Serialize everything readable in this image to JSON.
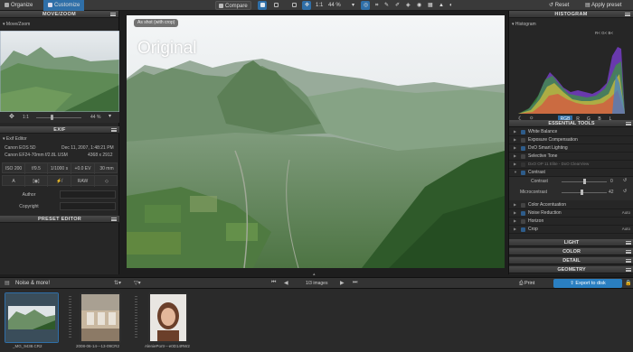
{
  "topbar": {
    "tab_organize": "Organize",
    "tab_customize": "Customize",
    "compare_label": "Compare",
    "zoom_ratio": "1:1",
    "zoom_percent": "44 %",
    "reset_label": "Reset",
    "apply_preset_label": "Apply preset"
  },
  "left": {
    "movezoom_title": "MOVE/ZOOM",
    "movezoom_sub": "Move/Zoom",
    "zoom_ratio": "1:1",
    "zoom_percent": "44 %",
    "exif_title": "EXIF",
    "exif_editor": "Exif Editor",
    "camera": "Canon EOS 5D",
    "date": "Dec 11, 2007, 1:48:21 PM",
    "lens": "Canon EF24-70mm f/2.8L USM",
    "dimensions": "4368 x 2912",
    "iso": "ISO 200",
    "aperture": "f/9.5",
    "shutter": "1/1000 s",
    "ev": "+0.0 EV",
    "focal": "30 mm",
    "mode_a": "A",
    "raw": "RAW",
    "author_label": "Author",
    "copyright_label": "Copyright",
    "preset_title": "PRESET EDITOR"
  },
  "viewer": {
    "badge": "As shot (with crop)",
    "overlay_title": "Original"
  },
  "right": {
    "histogram_title": "HISTOGRAM",
    "histogram_sub": "Histogram",
    "histogram_channels": "R< G< B<",
    "channel_tabs": [
      "RGB",
      "R",
      "G",
      "B",
      "L"
    ],
    "essential_title": "ESSENTIAL TOOLS",
    "tools": [
      {
        "label": "White Balance",
        "value": ""
      },
      {
        "label": "Exposure Compensation",
        "value": ""
      },
      {
        "label": "DxO Smart Lighting",
        "value": ""
      },
      {
        "label": "Selective Tone",
        "value": ""
      },
      {
        "label": "DxO ClearView",
        "value": ""
      },
      {
        "label": "Contrast",
        "value": ""
      }
    ],
    "clearview_dim": "DxO OP 11 Elite - DxO ClearView",
    "contrast_label": "Contrast",
    "contrast_value": "0",
    "microcontrast_label": "Microcontrast",
    "microcontrast_value": "42",
    "tools2": [
      {
        "label": "Color Accentuation",
        "value": ""
      },
      {
        "label": "Noise Reduction",
        "value": "Auto"
      },
      {
        "label": "Horizon",
        "value": ""
      },
      {
        "label": "Crop",
        "value": "Auto"
      }
    ],
    "sections": [
      "LIGHT",
      "COLOR",
      "DETAIL",
      "GEOMETRY"
    ]
  },
  "bottombar": {
    "project": "Noise & more!",
    "counter": "1/3 images",
    "print": "Print",
    "export": "Export to disk"
  },
  "filmstrip": [
    {
      "name": "_MG_9438.CR2"
    },
    {
      "name": "2008-06-14---13-09CR2"
    },
    {
      "name": "AleniePortr---e0D14RW2"
    }
  ],
  "colors": {
    "accent": "#2f6fa8",
    "export_bg": "#2a7fc1"
  }
}
